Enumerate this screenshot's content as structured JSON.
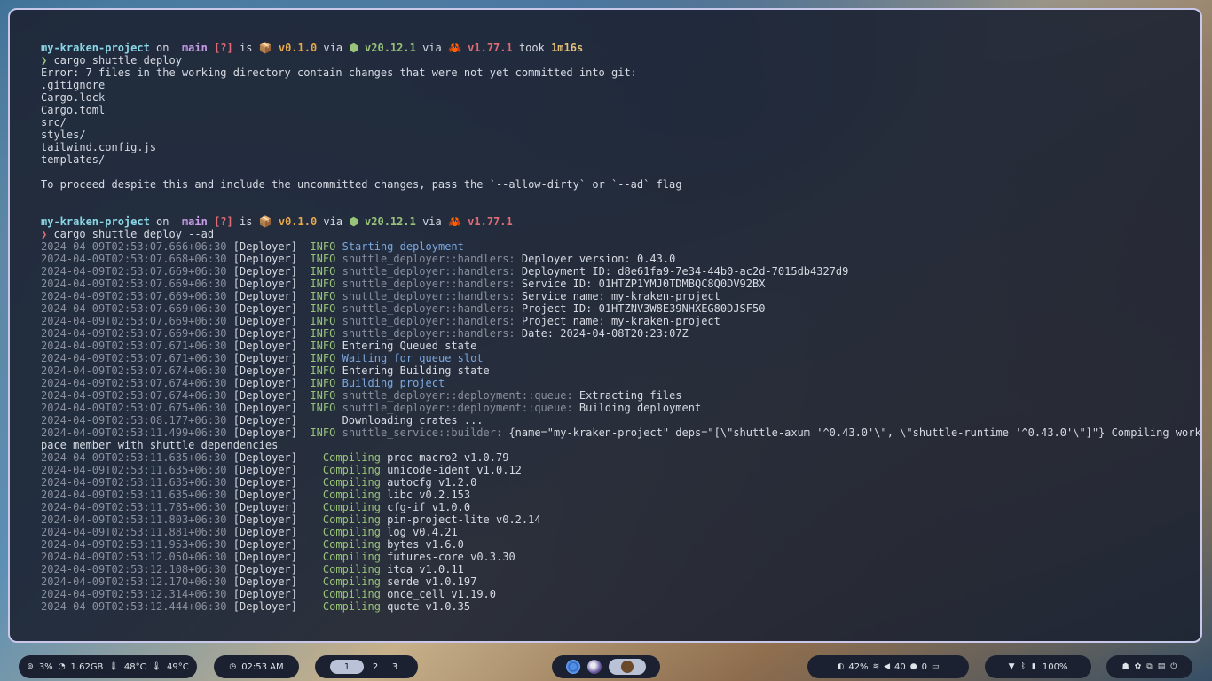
{
  "terminal": {
    "prompt1": {
      "project": "my-kraken-project",
      "on": " on ",
      "git_icon": "",
      "branch": " main",
      "status": " [?]",
      "is": " is ",
      "pkg_icon": "📦",
      "version": " v0.1.0",
      "via1": " via ",
      "node_icon": "⬢",
      "node_version": " v20.12.1",
      "via2": " via ",
      "rust_icon": "🦀",
      "rust_version": " v1.77.1",
      "took_label": " took ",
      "took_value": "1m16s",
      "arrow": "❯ ",
      "command": "cargo shuttle deploy"
    },
    "error_lines": [
      "Error: 7 files in the working directory contain changes that were not yet committed into git:",
      ".gitignore",
      "Cargo.lock",
      "Cargo.toml",
      "src/",
      "styles/",
      "tailwind.config.js",
      "templates/"
    ],
    "hint": "To proceed despite this and include the uncommitted changes, pass the `--allow-dirty` or `--ad` flag",
    "prompt2": {
      "project": "my-kraken-project",
      "on": " on ",
      "git_icon": "",
      "branch": " main",
      "status": " [?]",
      "is": " is ",
      "pkg_icon": "📦",
      "version": " v0.1.0",
      "via1": " via ",
      "node_icon": "⬢",
      "node_version": " v20.12.1",
      "via2": " via ",
      "rust_icon": "🦀",
      "rust_version": " v1.77.1",
      "arrow": "❯ ",
      "command": "cargo shuttle deploy --ad"
    },
    "log_lines": [
      {
        "ts": "2024-04-09T02:53:07.666+06:30",
        "tag": "[Deployer]",
        "level": "INFO",
        "module": "",
        "msg": "Starting deployment",
        "style": "blue"
      },
      {
        "ts": "2024-04-09T02:53:07.668+06:30",
        "tag": "[Deployer]",
        "level": "INFO",
        "module": "shuttle_deployer::handlers:",
        "msg": "Deployer version: 0.43.0",
        "style": "text"
      },
      {
        "ts": "2024-04-09T02:53:07.669+06:30",
        "tag": "[Deployer]",
        "level": "INFO",
        "module": "shuttle_deployer::handlers:",
        "msg": "Deployment ID: d8e61fa9-7e34-44b0-ac2d-7015db4327d9",
        "style": "text"
      },
      {
        "ts": "2024-04-09T02:53:07.669+06:30",
        "tag": "[Deployer]",
        "level": "INFO",
        "module": "shuttle_deployer::handlers:",
        "msg": "Service ID: 01HTZP1YMJ0TDMBQC8Q0DV92BX",
        "style": "text"
      },
      {
        "ts": "2024-04-09T02:53:07.669+06:30",
        "tag": "[Deployer]",
        "level": "INFO",
        "module": "shuttle_deployer::handlers:",
        "msg": "Service name: my-kraken-project",
        "style": "text"
      },
      {
        "ts": "2024-04-09T02:53:07.669+06:30",
        "tag": "[Deployer]",
        "level": "INFO",
        "module": "shuttle_deployer::handlers:",
        "msg": "Project ID: 01HTZNV3W8E39NHXEG80DJSF50",
        "style": "text"
      },
      {
        "ts": "2024-04-09T02:53:07.669+06:30",
        "tag": "[Deployer]",
        "level": "INFO",
        "module": "shuttle_deployer::handlers:",
        "msg": "Project name: my-kraken-project",
        "style": "text"
      },
      {
        "ts": "2024-04-09T02:53:07.669+06:30",
        "tag": "[Deployer]",
        "level": "INFO",
        "module": "shuttle_deployer::handlers:",
        "msg": "Date: 2024-04-08T20:23:07Z",
        "style": "text"
      },
      {
        "ts": "2024-04-09T02:53:07.671+06:30",
        "tag": "[Deployer]",
        "level": "INFO",
        "module": "",
        "msg": "Entering Queued state",
        "style": "text"
      },
      {
        "ts": "2024-04-09T02:53:07.671+06:30",
        "tag": "[Deployer]",
        "level": "INFO",
        "module": "",
        "msg": "Waiting for queue slot",
        "style": "blue"
      },
      {
        "ts": "2024-04-09T02:53:07.674+06:30",
        "tag": "[Deployer]",
        "level": "INFO",
        "module": "",
        "msg": "Entering Building state",
        "style": "text"
      },
      {
        "ts": "2024-04-09T02:53:07.674+06:30",
        "tag": "[Deployer]",
        "level": "INFO",
        "module": "",
        "msg": "Building project",
        "style": "blue"
      },
      {
        "ts": "2024-04-09T02:53:07.674+06:30",
        "tag": "[Deployer]",
        "level": "INFO",
        "module": "shuttle_deployer::deployment::queue:",
        "msg": "Extracting files",
        "style": "text"
      },
      {
        "ts": "2024-04-09T02:53:07.675+06:30",
        "tag": "[Deployer]",
        "level": "INFO",
        "module": "shuttle_deployer::deployment::queue:",
        "msg": "Building deployment",
        "style": "text"
      },
      {
        "ts": "2024-04-09T02:53:08.177+06:30",
        "tag": "[Deployer]",
        "level": "",
        "module": "",
        "msg": "Downloading crates ...",
        "style": "text"
      },
      {
        "ts": "2024-04-09T02:53:11.499+06:30",
        "tag": "[Deployer]",
        "level": "INFO",
        "module": "shuttle_service::builder:",
        "msg": "{name=\"my-kraken-project\" deps=\"[\\\"shuttle-axum '^0.43.0'\\\", \\\"shuttle-runtime '^0.43.0'\\\"]\"} Compiling works",
        "style": "text"
      }
    ],
    "wrap_line": "pace member with shuttle dependencies",
    "compile_lines": [
      {
        "ts": "2024-04-09T02:53:11.635+06:30",
        "tag": "[Deployer]",
        "verb": "Compiling",
        "crate": "proc-macro2 v1.0.79"
      },
      {
        "ts": "2024-04-09T02:53:11.635+06:30",
        "tag": "[Deployer]",
        "verb": "Compiling",
        "crate": "unicode-ident v1.0.12"
      },
      {
        "ts": "2024-04-09T02:53:11.635+06:30",
        "tag": "[Deployer]",
        "verb": "Compiling",
        "crate": "autocfg v1.2.0"
      },
      {
        "ts": "2024-04-09T02:53:11.635+06:30",
        "tag": "[Deployer]",
        "verb": "Compiling",
        "crate": "libc v0.2.153"
      },
      {
        "ts": "2024-04-09T02:53:11.785+06:30",
        "tag": "[Deployer]",
        "verb": "Compiling",
        "crate": "cfg-if v1.0.0"
      },
      {
        "ts": "2024-04-09T02:53:11.803+06:30",
        "tag": "[Deployer]",
        "verb": "Compiling",
        "crate": "pin-project-lite v0.2.14"
      },
      {
        "ts": "2024-04-09T02:53:11.881+06:30",
        "tag": "[Deployer]",
        "verb": "Compiling",
        "crate": "log v0.4.21"
      },
      {
        "ts": "2024-04-09T02:53:11.953+06:30",
        "tag": "[Deployer]",
        "verb": "Compiling",
        "crate": "bytes v1.6.0"
      },
      {
        "ts": "2024-04-09T02:53:12.050+06:30",
        "tag": "[Deployer]",
        "verb": "Compiling",
        "crate": "futures-core v0.3.30"
      },
      {
        "ts": "2024-04-09T02:53:12.108+06:30",
        "tag": "[Deployer]",
        "verb": "Compiling",
        "crate": "itoa v1.0.11"
      },
      {
        "ts": "2024-04-09T02:53:12.170+06:30",
        "tag": "[Deployer]",
        "verb": "Compiling",
        "crate": "serde v1.0.197"
      },
      {
        "ts": "2024-04-09T02:53:12.314+06:30",
        "tag": "[Deployer]",
        "verb": "Compiling",
        "crate": "once_cell v1.19.0"
      },
      {
        "ts": "2024-04-09T02:53:12.444+06:30",
        "tag": "[Deployer]",
        "verb": "Compiling",
        "crate": "quote v1.0.35"
      }
    ]
  },
  "taskbar": {
    "system": {
      "cpu": "3%",
      "mem": "1.62GB",
      "temp1": "48°C",
      "temp2": "49°C"
    },
    "clock": "02:53 AM",
    "workspaces": [
      "1",
      "2",
      "3"
    ],
    "active_workspace": "1",
    "status": {
      "brightness": "42%",
      "volume": "40",
      "mic": "0"
    },
    "right": {
      "battery": "100%"
    },
    "icons": {
      "cpu": "cpu-icon",
      "mem": "memory-icon",
      "temp": "thermometer-icon",
      "clock": "clock-icon",
      "brightness": "brightness-icon",
      "wifi": "wifi-icon",
      "volume": "volume-icon",
      "mic": "microphone-icon",
      "notif": "moon-icon",
      "keyboard": "keyboard-icon",
      "bluetooth": "bluetooth-icon",
      "battery": "battery-icon"
    },
    "apps": [
      "chromium",
      "firefox",
      "terminal"
    ]
  },
  "colors": {
    "border": "#c9c8ea",
    "terminal_bg": "#1c2232",
    "info": "#98c379",
    "accent_blue": "#7aa7e0"
  }
}
